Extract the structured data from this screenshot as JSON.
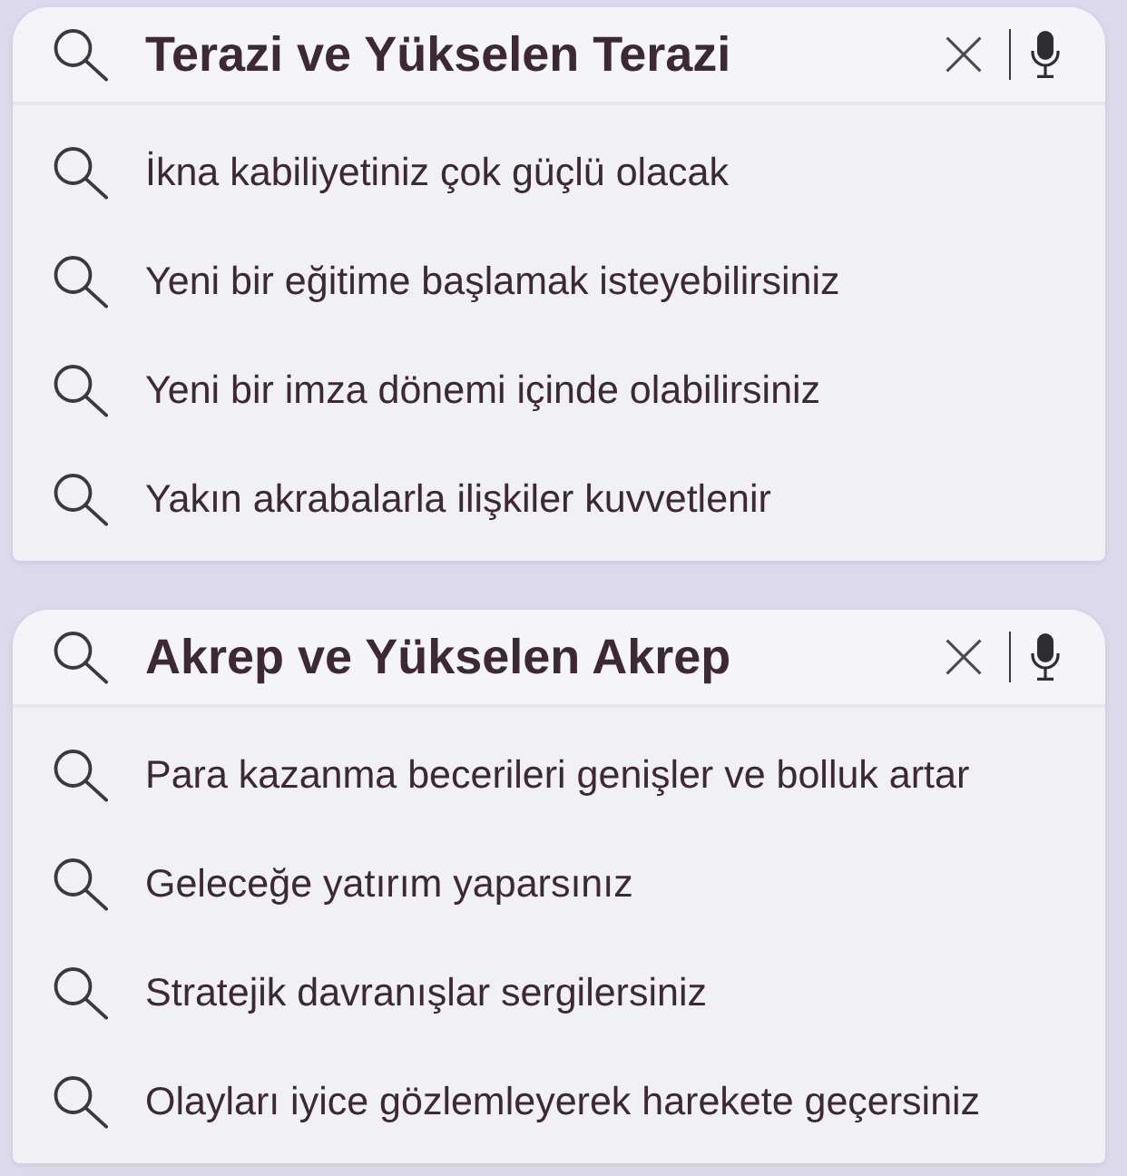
{
  "cards": [
    {
      "search": {
        "value": "Terazi ve Yükselen Terazi"
      },
      "suggestions": [
        "İkna kabiliyetiniz çok güçlü olacak",
        "Yeni bir eğitime başlamak isteyebilirsiniz",
        "Yeni bir imza dönemi içinde olabilirsiniz",
        "Yakın akrabalarla ilişkiler kuvvetlenir"
      ]
    },
    {
      "search": {
        "value": "Akrep ve Yükselen Akrep"
      },
      "suggestions": [
        "Para kazanma becerileri genişler ve bolluk artar",
        "Geleceğe yatırım yaparsınız",
        "Stratejik davranışlar sergilersiniz",
        "Olayları iyice gözlemleyerek harekete geçersiniz"
      ]
    }
  ]
}
